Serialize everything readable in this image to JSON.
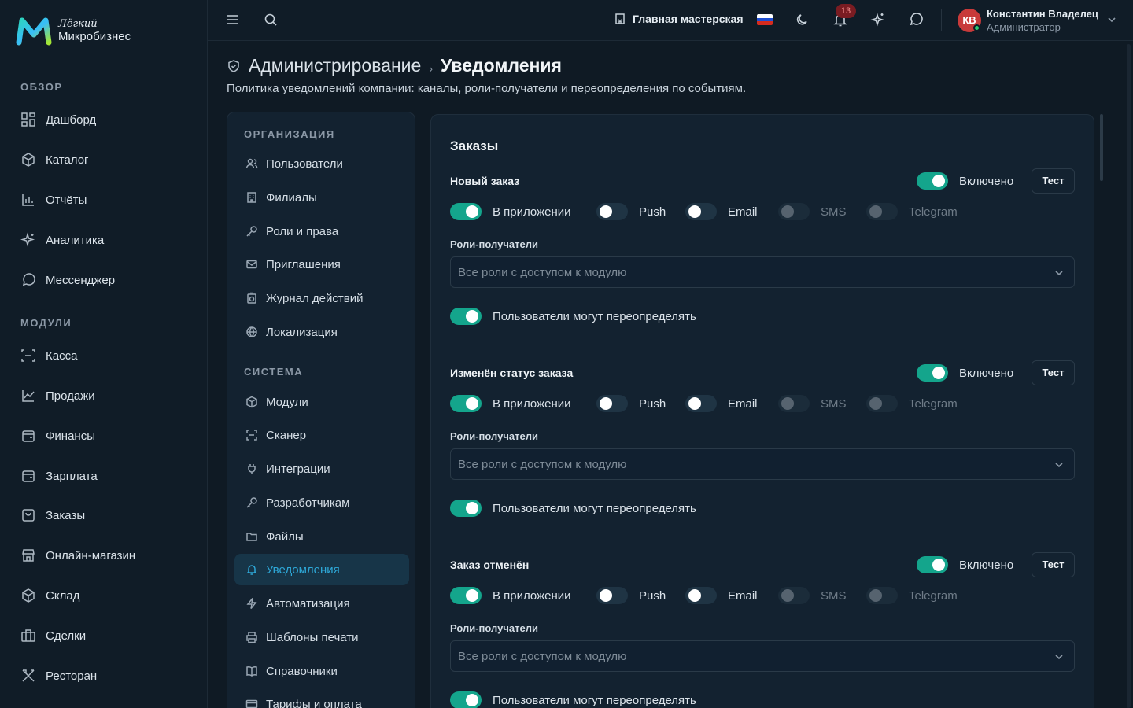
{
  "brand": {
    "top": "Лёгкий",
    "bottom": "Микробизнес"
  },
  "sidebar": {
    "sections": [
      "ОБЗОР",
      "МОДУЛИ"
    ],
    "items": [
      {
        "label": "Дашборд",
        "icon": "dashboard-icon"
      },
      {
        "label": "Каталог",
        "icon": "catalog-icon"
      },
      {
        "label": "Отчёты",
        "icon": "reports-icon"
      },
      {
        "label": "Аналитика",
        "icon": "analytics-icon"
      },
      {
        "label": "Мессенджер",
        "icon": "messenger-icon"
      },
      {
        "label": "Касса",
        "icon": "cashbox-icon"
      },
      {
        "label": "Продажи",
        "icon": "sales-icon"
      },
      {
        "label": "Финансы",
        "icon": "finance-icon"
      },
      {
        "label": "Зарплата",
        "icon": "payroll-icon"
      },
      {
        "label": "Заказы",
        "icon": "orders-icon"
      },
      {
        "label": "Онлайн-магазин",
        "icon": "store-icon"
      },
      {
        "label": "Склад",
        "icon": "warehouse-icon"
      },
      {
        "label": "Сделки",
        "icon": "deals-icon"
      },
      {
        "label": "Ресторан",
        "icon": "restaurant-icon"
      }
    ]
  },
  "topbar": {
    "workshop": "Главная мастерская",
    "notifications_count": "13",
    "user": {
      "initials": "КВ",
      "name": "Константин Владелец",
      "role": "Администратор"
    },
    "flag_colors": [
      "#ffffff",
      "#1f4fd1",
      "#d52b1e"
    ]
  },
  "header": {
    "crumb1": "Администрирование",
    "crumb_sep": "›",
    "crumb2": "Уведомления",
    "subtitle": "Политика уведомлений компании: каналы, роли-получатели и переопределения по событиям."
  },
  "settings_menu": {
    "sections": [
      "ОРГАНИЗАЦИЯ",
      "СИСТЕМА"
    ],
    "items": [
      "Пользователи",
      "Филиалы",
      "Роли и права",
      "Приглашения",
      "Журнал действий",
      "Локализация",
      "Модули",
      "Сканер",
      "Интеграции",
      "Разработчикам",
      "Файлы",
      "Уведомления",
      "Автоматизация",
      "Шаблоны печати",
      "Справочники",
      "Тарифы и оплата"
    ],
    "active": "Уведомления"
  },
  "panel": {
    "title": "Заказы",
    "enabled_label": "Включено",
    "test_label": "Тест",
    "channels": [
      "В приложении",
      "Push",
      "Email",
      "SMS",
      "Telegram"
    ],
    "roles_label": "Роли-получатели",
    "roles_placeholder": "Все роли с доступом к модулю",
    "override_label": "Пользователи могут переопределять",
    "events": [
      {
        "title": "Новый заказ",
        "enabled": true,
        "channels": [
          "on",
          "off",
          "off",
          "disabled",
          "disabled"
        ],
        "override": true
      },
      {
        "title": "Изменён статус заказа",
        "enabled": true,
        "channels": [
          "on",
          "off",
          "off",
          "disabled",
          "disabled"
        ],
        "override": true
      },
      {
        "title": "Заказ отменён",
        "enabled": true,
        "channels": [
          "on",
          "off",
          "off",
          "disabled",
          "disabled"
        ],
        "override": true
      }
    ]
  },
  "colors": {
    "accent": "#14a58c",
    "active_menu": "#2ea8d8",
    "background": "#0f1a24"
  }
}
